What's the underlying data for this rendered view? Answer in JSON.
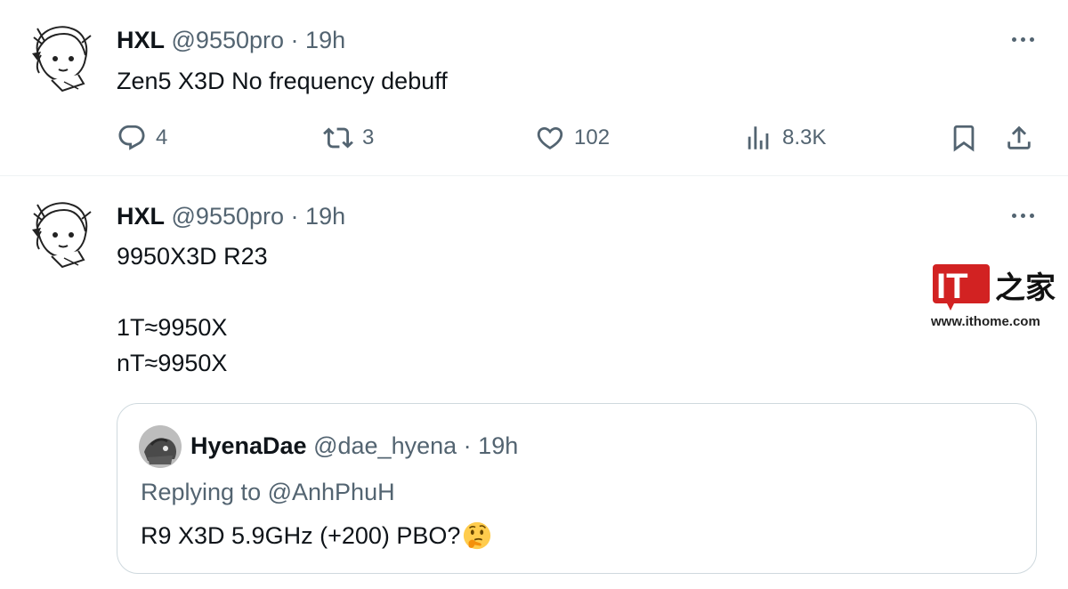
{
  "tweets": [
    {
      "author_name": "HXL",
      "handle": "@9550pro",
      "separator": "·",
      "time": "19h",
      "text": "Zen5 X3D No frequency debuff",
      "stats": {
        "replies": "4",
        "reposts": "3",
        "likes": "102",
        "views": "8.3K"
      }
    },
    {
      "author_name": "HXL",
      "handle": "@9550pro",
      "separator": "·",
      "time": "19h",
      "lines": [
        "9950X3D R23",
        "",
        "1T≈9950X",
        "nT≈9950X"
      ],
      "quote": {
        "author_name": "HyenaDae",
        "handle": "@dae_hyena",
        "separator": "·",
        "time": "19h",
        "replying_prefix": "Replying to ",
        "replying_to": "@AnhPhuH",
        "text": "R9 X3D 5.9GHz (+200) PBO?",
        "emoji": "thinking-face"
      }
    }
  ],
  "watermark": {
    "logo_text": "IT之家",
    "url": "www.ithome.com",
    "brand_color": "#d22222"
  },
  "icons": [
    "more-icon",
    "reply-icon",
    "repost-icon",
    "like-icon",
    "views-icon",
    "bookmark-icon",
    "share-icon"
  ]
}
